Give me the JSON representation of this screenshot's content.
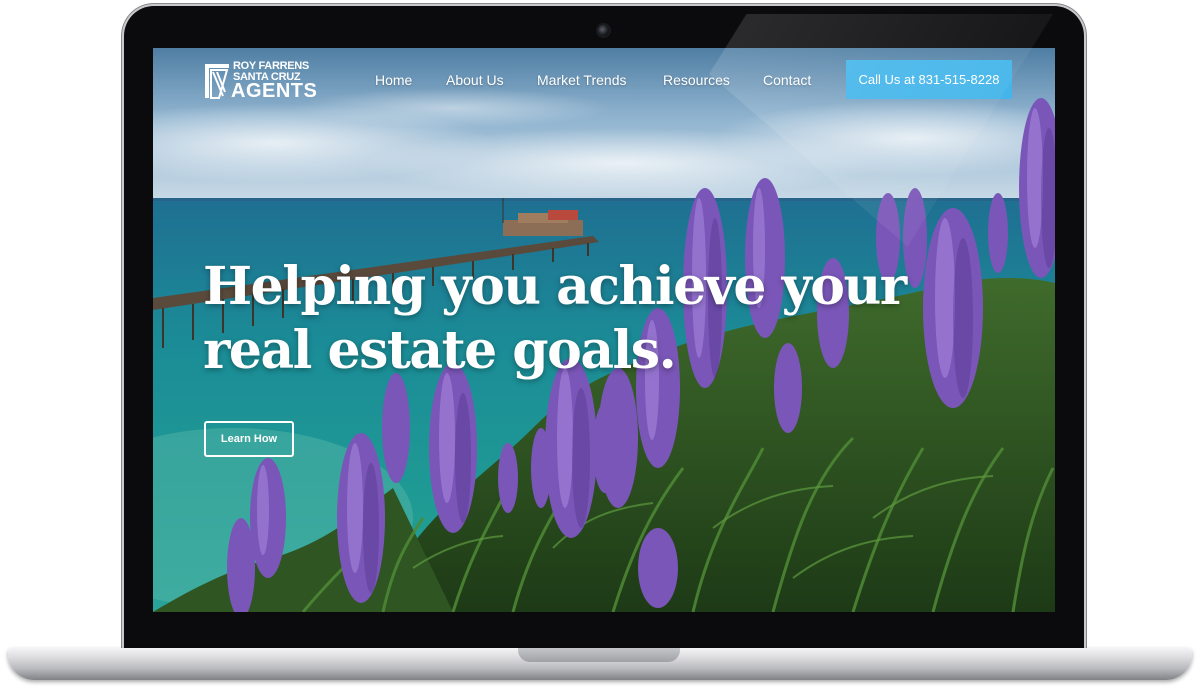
{
  "logo": {
    "line1": "ROY FARRENS",
    "line2": "SANTA CRUZ",
    "line3": "AGENTS"
  },
  "nav": {
    "items": [
      {
        "label": "Home"
      },
      {
        "label": "About Us"
      },
      {
        "label": "Market Trends"
      },
      {
        "label": "Resources"
      },
      {
        "label": "Contact"
      }
    ],
    "cta_label": "Call Us at 831-515-8228"
  },
  "hero": {
    "title_line1": "Helping you achieve your",
    "title_line2": "real estate goals.",
    "button_label": "Learn How"
  },
  "colors": {
    "cta_background": "#43b5ea",
    "text": "#ffffff",
    "flower_purple": "#7a56b8",
    "ocean": "#1f8f98"
  }
}
